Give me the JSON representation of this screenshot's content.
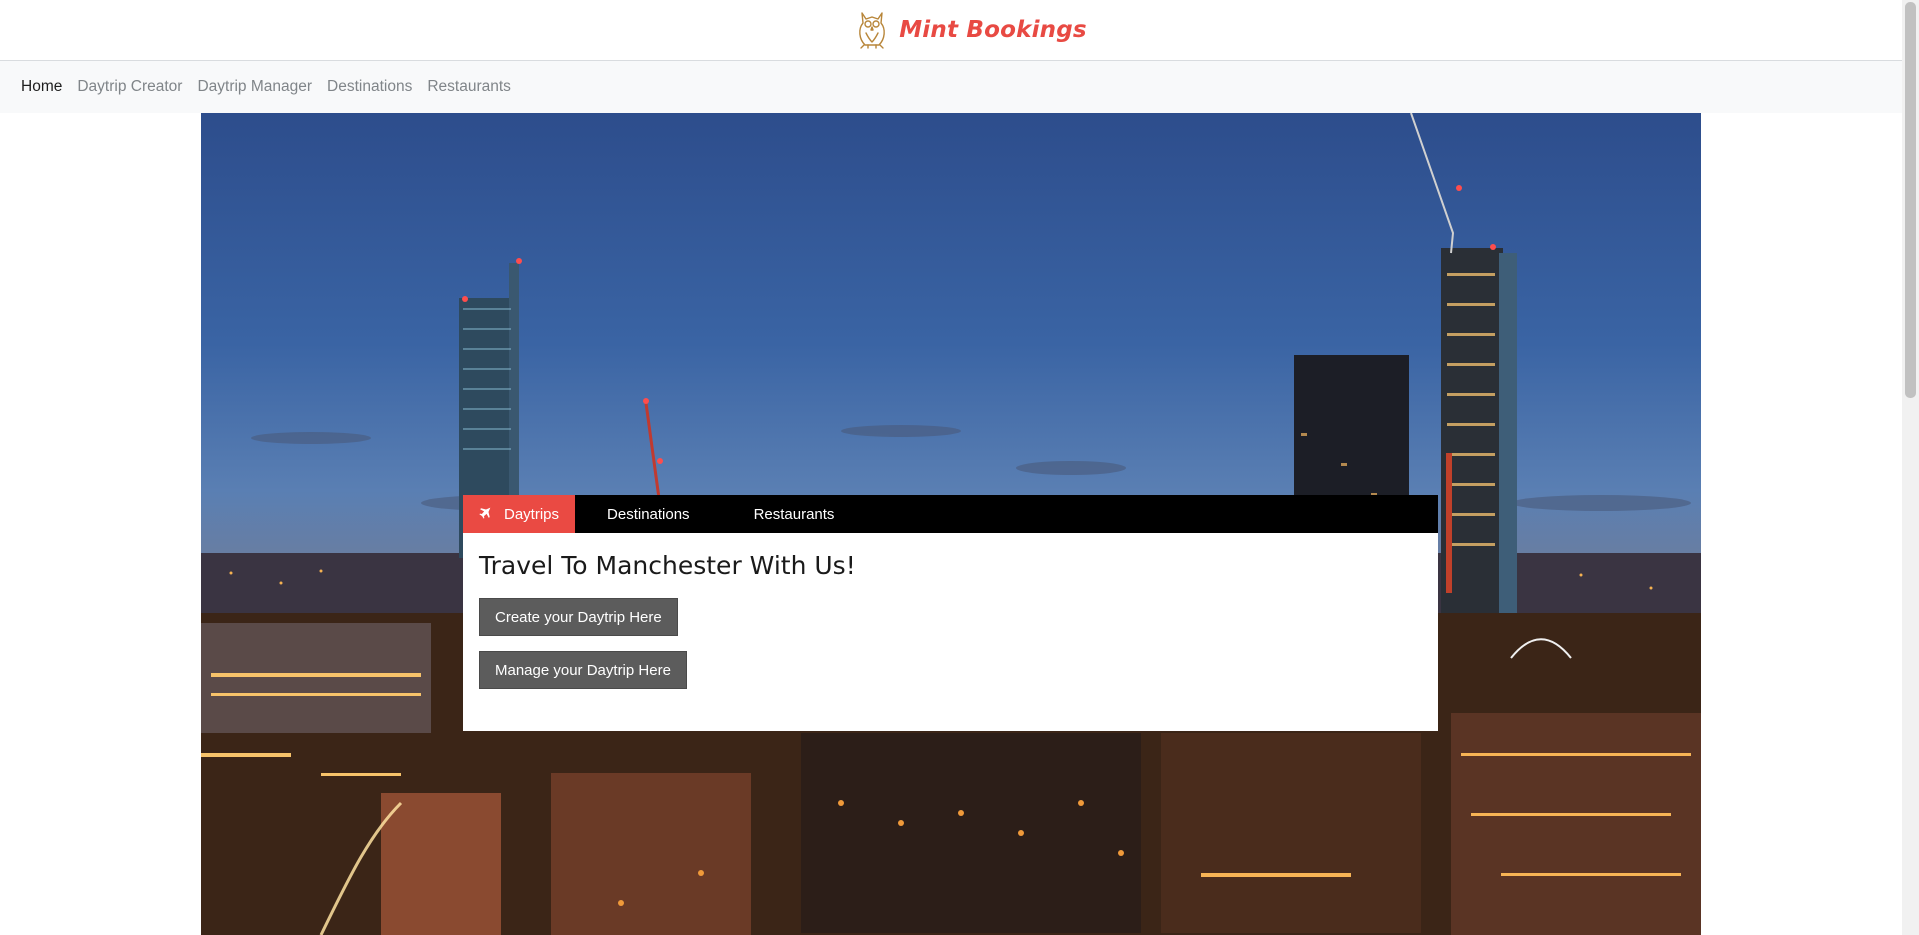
{
  "header": {
    "brand_name": "Mint Bookings",
    "logo_icon": "owl-icon",
    "brand_color": "#e84a43"
  },
  "nav": {
    "items": [
      {
        "label": "Home",
        "active": true
      },
      {
        "label": "Daytrip Creator",
        "active": false
      },
      {
        "label": "Daytrip Manager",
        "active": false
      },
      {
        "label": "Destinations",
        "active": false
      },
      {
        "label": "Restaurants",
        "active": false
      }
    ]
  },
  "hero": {
    "image_description_icon": "city-skyline-image"
  },
  "panel": {
    "tabs": [
      {
        "label": "Daytrips",
        "icon": "plane-icon",
        "active": true
      },
      {
        "label": "Destinations",
        "active": false
      },
      {
        "label": "Restaurants",
        "active": false
      }
    ],
    "title": "Travel To Manchester With Us!",
    "create_button": "Create your Daytrip Here",
    "manage_button": "Manage your Daytrip Here",
    "accent_color": "#ea4a43"
  }
}
